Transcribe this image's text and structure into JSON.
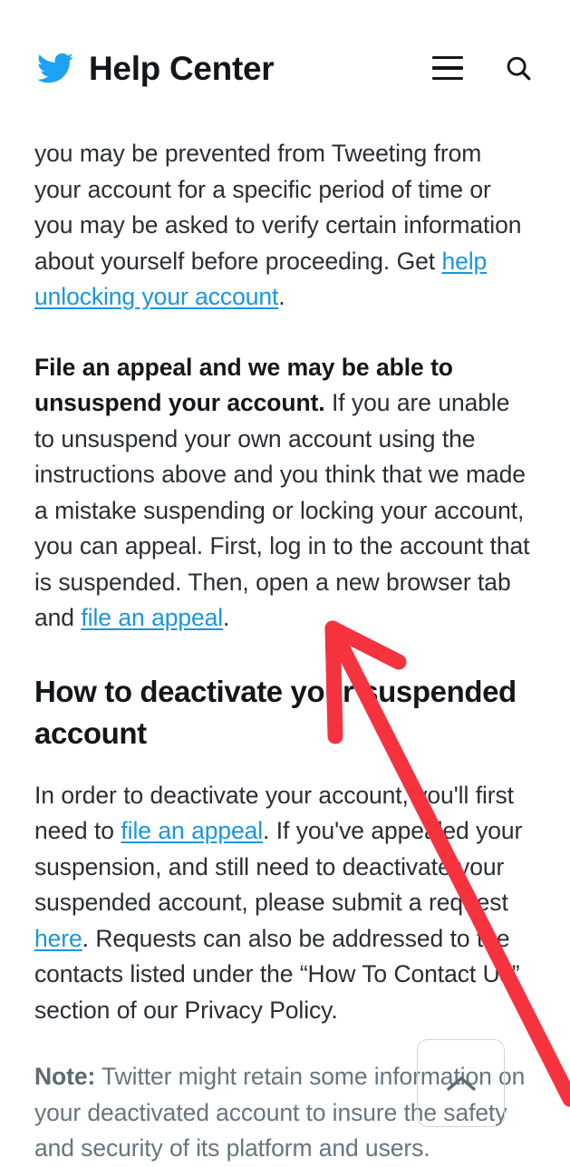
{
  "header": {
    "logo_icon": "twitter-bird-icon",
    "title": "Help Center",
    "menu_icon": "hamburger-menu-icon",
    "search_icon": "search-icon",
    "brand_color": "#1da1f2",
    "title_color": "#14171a"
  },
  "article": {
    "paragraph_1": {
      "text_before_link": "you may be prevented from Tweeting from your account for a specific period of time or you may be asked to verify certain information about yourself before proceeding. Get ",
      "link_text": "help unlocking your account",
      "text_after_link": "."
    },
    "paragraph_2": {
      "bold_lead": "File an appeal and we may be able to unsuspend your account.",
      "text_before_link": " If you are unable to unsuspend your own account using the instructions above and you think that we made a mistake suspending or locking your account, you can appeal. First, log in to the account that is suspended. Then, open a new browser tab and ",
      "link_text": "file an appeal",
      "text_after_link": "."
    },
    "heading": "How to deactivate your suspended account",
    "paragraph_3": {
      "text_before_link_1": "In order to deactivate your account, you'll first need to ",
      "link_text_1": "file an appeal",
      "text_between_links": ". If you've appealed your suspension, and still need to deactivate your suspended account, please submit a request ",
      "link_text_2": "here",
      "text_after_link_2": ". Requests can also be addressed to the contacts listed under the “How To Contact Us” section of our Privacy Policy."
    },
    "note": {
      "label": "Note:",
      "text": " Twitter might retain some information on your deactivated account to insure the safety and security of its platform and users."
    },
    "link_color": "#1b95e0",
    "body_text_color": "#292f33",
    "note_text_color": "#66757f"
  },
  "scroll_top_button": {
    "icon": "chevron-up-icon",
    "border_color": "#ccd6dd"
  },
  "annotation": {
    "type": "arrow",
    "color": "#f5333f",
    "points_to": "file an appeal"
  }
}
